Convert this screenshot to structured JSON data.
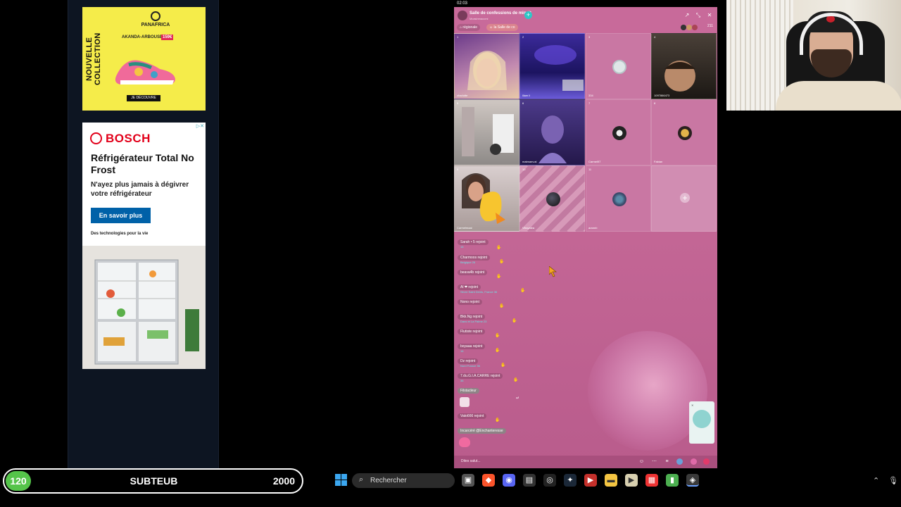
{
  "ads": {
    "panafrica": {
      "vertical_text": "NOUVELLE COLLECTION",
      "brand": "PANAFRICA",
      "product": "AKANDA-ARBOUSE",
      "price": "159€",
      "cta": "JE DÉCOUVRE"
    },
    "bosch": {
      "brand": "BOSCH",
      "headline": "Réfrigérateur Total No Frost",
      "subline": "N'ayez plus jamais à dégivrer votre réfrigérateur",
      "button": "En savoir plus",
      "tagline": "Des technologies pour la vie"
    }
  },
  "phone": {
    "time": "02:03"
  },
  "tiktok": {
    "room_title": "Salle de confessions de minuit",
    "room_sub": "Mcasinmaccmi",
    "chip_regionale": "régionale",
    "chip_salle": "la Salle de co",
    "viewers": "211",
    "tiles": [
      {
        "num": "1",
        "caption": "charlotte"
      },
      {
        "num": "2",
        "caption": "iliam li"
      },
      {
        "num": "3",
        "caption": "334"
      },
      {
        "num": "4",
        "caption": "1097866473"
      },
      {
        "num": "5",
        "caption": ""
      },
      {
        "num": "6",
        "caption": "matmaev.al"
      },
      {
        "num": "7",
        "caption": "Carmel97"
      },
      {
        "num": "8",
        "caption": "Fabian"
      },
      {
        "num": "9",
        "caption": "Carmelmaai"
      },
      {
        "num": "10",
        "caption": "Viksyalea"
      },
      {
        "num": "11",
        "caption": "arannb"
      },
      {
        "num": "12",
        "caption": ""
      }
    ],
    "chat": [
      {
        "text": "Sarah • 5 rejoint",
        "meta": "15"
      },
      {
        "text": "Charmoos rejoint",
        "meta": "Belgique 26"
      },
      {
        "text": "beava4b rejoint",
        "meta": ""
      },
      {
        "text": "Al ❤ rejoint",
        "meta": "Sèvre Saint Denis, France 36"
      },
      {
        "text": "Nono rejoint",
        "meta": ""
      },
      {
        "text": "Bkk.Ng rejoint",
        "meta": "Dans et La Palme 23"
      },
      {
        "text": "Flutiste rejoint",
        "meta": ""
      },
      {
        "text": "boyaaa rejoint",
        "meta": "16"
      },
      {
        "text": "Dz rejoint",
        "meta": "Nord France 36"
      },
      {
        "text": "7.du.G.I.A.CARRE rejoint",
        "meta": "36"
      },
      {
        "text": "Filstacleur",
        "meta": ""
      },
      {
        "text": "Vato666 rejoint",
        "meta": ""
      },
      {
        "text": "Incarcéré @Enchanteresse",
        "meta": ""
      }
    ],
    "input_placeholder": "Dites salut..."
  },
  "scorebar": {
    "level": "120",
    "name": "SUBTEUB",
    "goal": "2000"
  },
  "taskbar": {
    "search_label": "Rechercher"
  },
  "colors": {
    "tiktok_pink": "#c86a9a",
    "score_green": "#55c44a",
    "bosch_red": "#e2001a",
    "bosch_blue": "#0061a8"
  }
}
